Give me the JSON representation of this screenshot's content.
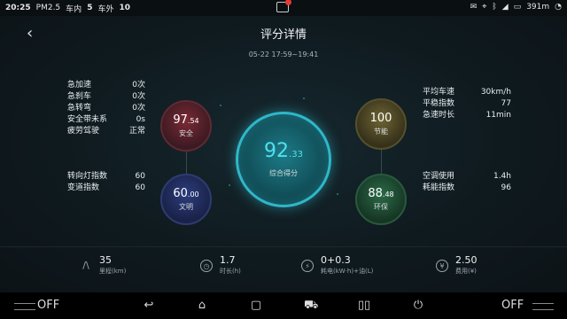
{
  "status_bar": {
    "time": "20:25",
    "pm25_label": "PM2.5",
    "inside_label": "车内",
    "inside_value": "5",
    "outside_label": "车外",
    "outside_value": "10",
    "storage": "391m"
  },
  "header": {
    "title": "评分详情",
    "date_range": "05-22 17:59~19:41"
  },
  "left_top_stats": [
    {
      "label": "急加速",
      "value": "0次"
    },
    {
      "label": "急刹车",
      "value": "0次"
    },
    {
      "label": "急转弯",
      "value": "0次"
    },
    {
      "label": "安全带未系",
      "value": "0s"
    },
    {
      "label": "疲劳驾驶",
      "value": "正常"
    }
  ],
  "left_bottom_stats": [
    {
      "label": "转向灯指数",
      "value": "60"
    },
    {
      "label": "变道指数",
      "value": "60"
    }
  ],
  "right_top_stats": [
    {
      "label": "平均车速",
      "value": "30km/h"
    },
    {
      "label": "平稳指数",
      "value": "77"
    },
    {
      "label": "急速时长",
      "value": "11min"
    }
  ],
  "right_bottom_stats": [
    {
      "label": "空调使用",
      "value": "1.4h"
    },
    {
      "label": "耗能指数",
      "value": "96"
    }
  ],
  "scores": {
    "safety": {
      "int": "97",
      "dec": ".54",
      "label": "安全"
    },
    "civil": {
      "int": "60",
      "dec": ".00",
      "label": "文明"
    },
    "energy": {
      "int": "100",
      "dec": "",
      "label": "节能"
    },
    "eco": {
      "int": "88",
      "dec": ".48",
      "label": "环保"
    },
    "total": {
      "int": "92",
      "dec": ".33",
      "label": "综合得分"
    }
  },
  "summary": [
    {
      "icon": "road-icon",
      "value": "35",
      "label": "里程(km)"
    },
    {
      "icon": "clock-icon",
      "value": "1.7",
      "label": "时长(h)"
    },
    {
      "icon": "energy-drop-icon",
      "value": "0+0.3",
      "label": "耗电(kW·h)+油(L)"
    },
    {
      "icon": "yuan-icon",
      "value": "2.50",
      "label": "费用(¥)"
    }
  ],
  "nav_bar": {
    "left_fan_label": "OFF",
    "right_fan_label": "OFF"
  },
  "colors": {
    "accent": "#2fb7c9",
    "safety": "#7a2a36",
    "civil": "#2c3d7e",
    "energy": "#6f6534",
    "eco": "#2b6b48"
  }
}
